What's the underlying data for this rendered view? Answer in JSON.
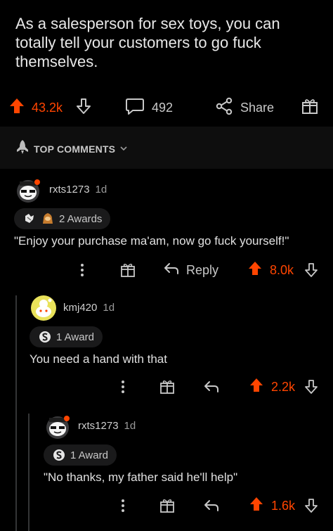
{
  "post": {
    "title": "As a salesperson for sex toys, you can totally tell your customers to go fuck themselves.",
    "upvotes": "43.2k",
    "comments_count": "492",
    "share_label": "Share"
  },
  "section": {
    "label": "TOP COMMENTS"
  },
  "comments": [
    {
      "user": "rxts1273",
      "age": "1d",
      "awards_label": "2 Awards",
      "text": "\"Enjoy your purchase ma'am,  now go fuck yourself!\"",
      "reply_label": "Reply",
      "score": "8.0k"
    },
    {
      "user": "kmj420",
      "age": "1d",
      "awards_label": "1 Award",
      "text": "You need a hand with that",
      "score": "2.2k"
    },
    {
      "user": "rxts1273",
      "age": "1d",
      "awards_label": "1 Award",
      "text": "\"No thanks, my father said he'll help\"",
      "score": "1.6k"
    }
  ],
  "colors": {
    "upvote": "#ff4500",
    "background": "#000000",
    "text": "#d7dadc"
  }
}
